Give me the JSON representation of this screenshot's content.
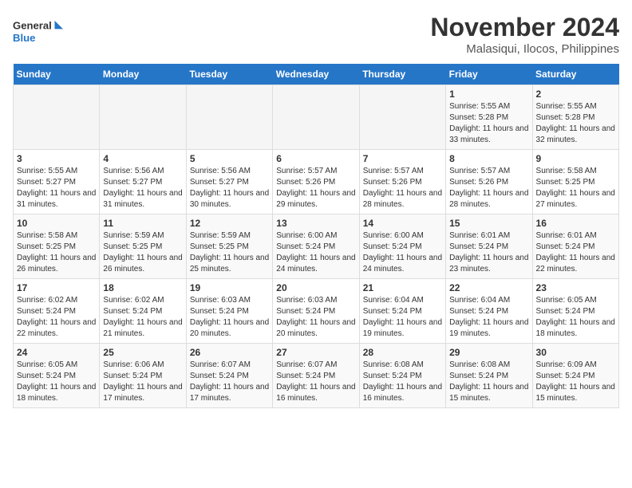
{
  "logo": {
    "line1": "General",
    "line2": "Blue"
  },
  "title": "November 2024",
  "subtitle": "Malasiqui, Ilocos, Philippines",
  "weekdays": [
    "Sunday",
    "Monday",
    "Tuesday",
    "Wednesday",
    "Thursday",
    "Friday",
    "Saturday"
  ],
  "weeks": [
    [
      {
        "day": "",
        "empty": true
      },
      {
        "day": "",
        "empty": true
      },
      {
        "day": "",
        "empty": true
      },
      {
        "day": "",
        "empty": true
      },
      {
        "day": "",
        "empty": true
      },
      {
        "day": "1",
        "sunrise": "Sunrise: 5:55 AM",
        "sunset": "Sunset: 5:28 PM",
        "daylight": "Daylight: 11 hours and 33 minutes."
      },
      {
        "day": "2",
        "sunrise": "Sunrise: 5:55 AM",
        "sunset": "Sunset: 5:28 PM",
        "daylight": "Daylight: 11 hours and 32 minutes."
      }
    ],
    [
      {
        "day": "3",
        "sunrise": "Sunrise: 5:55 AM",
        "sunset": "Sunset: 5:27 PM",
        "daylight": "Daylight: 11 hours and 31 minutes."
      },
      {
        "day": "4",
        "sunrise": "Sunrise: 5:56 AM",
        "sunset": "Sunset: 5:27 PM",
        "daylight": "Daylight: 11 hours and 31 minutes."
      },
      {
        "day": "5",
        "sunrise": "Sunrise: 5:56 AM",
        "sunset": "Sunset: 5:27 PM",
        "daylight": "Daylight: 11 hours and 30 minutes."
      },
      {
        "day": "6",
        "sunrise": "Sunrise: 5:57 AM",
        "sunset": "Sunset: 5:26 PM",
        "daylight": "Daylight: 11 hours and 29 minutes."
      },
      {
        "day": "7",
        "sunrise": "Sunrise: 5:57 AM",
        "sunset": "Sunset: 5:26 PM",
        "daylight": "Daylight: 11 hours and 28 minutes."
      },
      {
        "day": "8",
        "sunrise": "Sunrise: 5:57 AM",
        "sunset": "Sunset: 5:26 PM",
        "daylight": "Daylight: 11 hours and 28 minutes."
      },
      {
        "day": "9",
        "sunrise": "Sunrise: 5:58 AM",
        "sunset": "Sunset: 5:25 PM",
        "daylight": "Daylight: 11 hours and 27 minutes."
      }
    ],
    [
      {
        "day": "10",
        "sunrise": "Sunrise: 5:58 AM",
        "sunset": "Sunset: 5:25 PM",
        "daylight": "Daylight: 11 hours and 26 minutes."
      },
      {
        "day": "11",
        "sunrise": "Sunrise: 5:59 AM",
        "sunset": "Sunset: 5:25 PM",
        "daylight": "Daylight: 11 hours and 26 minutes."
      },
      {
        "day": "12",
        "sunrise": "Sunrise: 5:59 AM",
        "sunset": "Sunset: 5:25 PM",
        "daylight": "Daylight: 11 hours and 25 minutes."
      },
      {
        "day": "13",
        "sunrise": "Sunrise: 6:00 AM",
        "sunset": "Sunset: 5:24 PM",
        "daylight": "Daylight: 11 hours and 24 minutes."
      },
      {
        "day": "14",
        "sunrise": "Sunrise: 6:00 AM",
        "sunset": "Sunset: 5:24 PM",
        "daylight": "Daylight: 11 hours and 24 minutes."
      },
      {
        "day": "15",
        "sunrise": "Sunrise: 6:01 AM",
        "sunset": "Sunset: 5:24 PM",
        "daylight": "Daylight: 11 hours and 23 minutes."
      },
      {
        "day": "16",
        "sunrise": "Sunrise: 6:01 AM",
        "sunset": "Sunset: 5:24 PM",
        "daylight": "Daylight: 11 hours and 22 minutes."
      }
    ],
    [
      {
        "day": "17",
        "sunrise": "Sunrise: 6:02 AM",
        "sunset": "Sunset: 5:24 PM",
        "daylight": "Daylight: 11 hours and 22 minutes."
      },
      {
        "day": "18",
        "sunrise": "Sunrise: 6:02 AM",
        "sunset": "Sunset: 5:24 PM",
        "daylight": "Daylight: 11 hours and 21 minutes."
      },
      {
        "day": "19",
        "sunrise": "Sunrise: 6:03 AM",
        "sunset": "Sunset: 5:24 PM",
        "daylight": "Daylight: 11 hours and 20 minutes."
      },
      {
        "day": "20",
        "sunrise": "Sunrise: 6:03 AM",
        "sunset": "Sunset: 5:24 PM",
        "daylight": "Daylight: 11 hours and 20 minutes."
      },
      {
        "day": "21",
        "sunrise": "Sunrise: 6:04 AM",
        "sunset": "Sunset: 5:24 PM",
        "daylight": "Daylight: 11 hours and 19 minutes."
      },
      {
        "day": "22",
        "sunrise": "Sunrise: 6:04 AM",
        "sunset": "Sunset: 5:24 PM",
        "daylight": "Daylight: 11 hours and 19 minutes."
      },
      {
        "day": "23",
        "sunrise": "Sunrise: 6:05 AM",
        "sunset": "Sunset: 5:24 PM",
        "daylight": "Daylight: 11 hours and 18 minutes."
      }
    ],
    [
      {
        "day": "24",
        "sunrise": "Sunrise: 6:05 AM",
        "sunset": "Sunset: 5:24 PM",
        "daylight": "Daylight: 11 hours and 18 minutes."
      },
      {
        "day": "25",
        "sunrise": "Sunrise: 6:06 AM",
        "sunset": "Sunset: 5:24 PM",
        "daylight": "Daylight: 11 hours and 17 minutes."
      },
      {
        "day": "26",
        "sunrise": "Sunrise: 6:07 AM",
        "sunset": "Sunset: 5:24 PM",
        "daylight": "Daylight: 11 hours and 17 minutes."
      },
      {
        "day": "27",
        "sunrise": "Sunrise: 6:07 AM",
        "sunset": "Sunset: 5:24 PM",
        "daylight": "Daylight: 11 hours and 16 minutes."
      },
      {
        "day": "28",
        "sunrise": "Sunrise: 6:08 AM",
        "sunset": "Sunset: 5:24 PM",
        "daylight": "Daylight: 11 hours and 16 minutes."
      },
      {
        "day": "29",
        "sunrise": "Sunrise: 6:08 AM",
        "sunset": "Sunset: 5:24 PM",
        "daylight": "Daylight: 11 hours and 15 minutes."
      },
      {
        "day": "30",
        "sunrise": "Sunrise: 6:09 AM",
        "sunset": "Sunset: 5:24 PM",
        "daylight": "Daylight: 11 hours and 15 minutes."
      }
    ]
  ]
}
